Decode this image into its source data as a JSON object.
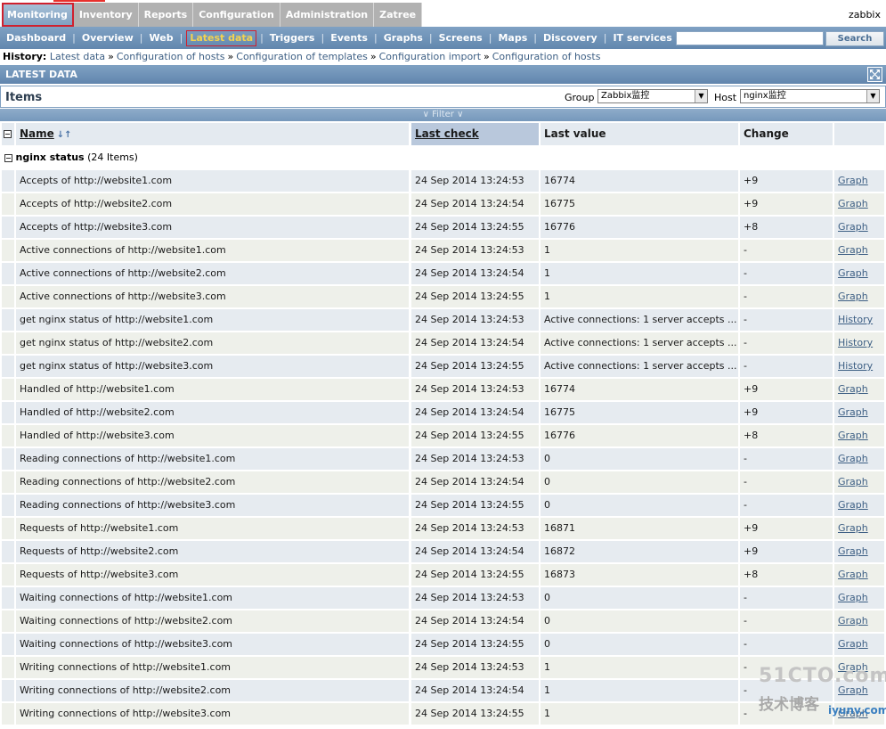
{
  "main_menu": [
    "Monitoring",
    "Inventory",
    "Reports",
    "Configuration",
    "Administration",
    "Zatree"
  ],
  "username": "zabbix",
  "sub_menu": [
    "Dashboard",
    "Overview",
    "Web",
    "Latest data",
    "Triggers",
    "Events",
    "Graphs",
    "Screens",
    "Maps",
    "Discovery",
    "IT services"
  ],
  "search": {
    "value": "",
    "button": "Search"
  },
  "history": {
    "label": "History:",
    "links": [
      "Latest data",
      "Configuration of hosts",
      "Configuration of templates",
      "Configuration import",
      "Configuration of hosts"
    ]
  },
  "section_title": "LATEST DATA",
  "items_title": "Items",
  "filter": {
    "group_label": "Group",
    "group_value": "Zabbix监控",
    "host_label": "Host",
    "host_value": "nginx监控",
    "toggle_label": "Filter"
  },
  "table": {
    "columns": {
      "name": "Name",
      "last_check": "Last check",
      "last_value": "Last value",
      "change": "Change"
    },
    "group_name": "nginx status",
    "group_count": "(24 Items)",
    "rows": [
      {
        "name": "Accepts of http://website1.com",
        "last_check": "24 Sep 2014 13:24:53",
        "last_value": "16774",
        "change": "+9",
        "action": "Graph"
      },
      {
        "name": "Accepts of http://website2.com",
        "last_check": "24 Sep 2014 13:24:54",
        "last_value": "16775",
        "change": "+9",
        "action": "Graph"
      },
      {
        "name": "Accepts of http://website3.com",
        "last_check": "24 Sep 2014 13:24:55",
        "last_value": "16776",
        "change": "+8",
        "action": "Graph"
      },
      {
        "name": "Active connections of http://website1.com",
        "last_check": "24 Sep 2014 13:24:53",
        "last_value": "1",
        "change": "-",
        "action": "Graph"
      },
      {
        "name": "Active connections of http://website2.com",
        "last_check": "24 Sep 2014 13:24:54",
        "last_value": "1",
        "change": "-",
        "action": "Graph"
      },
      {
        "name": "Active connections of http://website3.com",
        "last_check": "24 Sep 2014 13:24:55",
        "last_value": "1",
        "change": "-",
        "action": "Graph"
      },
      {
        "name": "get nginx status of http://website1.com",
        "last_check": "24 Sep 2014 13:24:53",
        "last_value": "Active connections: 1 server accepts ...",
        "change": "-",
        "action": "History"
      },
      {
        "name": "get nginx status of http://website2.com",
        "last_check": "24 Sep 2014 13:24:54",
        "last_value": "Active connections: 1 server accepts ...",
        "change": "-",
        "action": "History"
      },
      {
        "name": "get nginx status of http://website3.com",
        "last_check": "24 Sep 2014 13:24:55",
        "last_value": "Active connections: 1 server accepts ...",
        "change": "-",
        "action": "History"
      },
      {
        "name": "Handled of http://website1.com",
        "last_check": "24 Sep 2014 13:24:53",
        "last_value": "16774",
        "change": "+9",
        "action": "Graph"
      },
      {
        "name": "Handled of http://website2.com",
        "last_check": "24 Sep 2014 13:24:54",
        "last_value": "16775",
        "change": "+9",
        "action": "Graph"
      },
      {
        "name": "Handled of http://website3.com",
        "last_check": "24 Sep 2014 13:24:55",
        "last_value": "16776",
        "change": "+8",
        "action": "Graph"
      },
      {
        "name": "Reading connections of http://website1.com",
        "last_check": "24 Sep 2014 13:24:53",
        "last_value": "0",
        "change": "-",
        "action": "Graph"
      },
      {
        "name": "Reading connections of http://website2.com",
        "last_check": "24 Sep 2014 13:24:54",
        "last_value": "0",
        "change": "-",
        "action": "Graph"
      },
      {
        "name": "Reading connections of http://website3.com",
        "last_check": "24 Sep 2014 13:24:55",
        "last_value": "0",
        "change": "-",
        "action": "Graph"
      },
      {
        "name": "Requests of http://website1.com",
        "last_check": "24 Sep 2014 13:24:53",
        "last_value": "16871",
        "change": "+9",
        "action": "Graph"
      },
      {
        "name": "Requests of http://website2.com",
        "last_check": "24 Sep 2014 13:24:54",
        "last_value": "16872",
        "change": "+9",
        "action": "Graph"
      },
      {
        "name": "Requests of http://website3.com",
        "last_check": "24 Sep 2014 13:24:55",
        "last_value": "16873",
        "change": "+8",
        "action": "Graph"
      },
      {
        "name": "Waiting connections of http://website1.com",
        "last_check": "24 Sep 2014 13:24:53",
        "last_value": "0",
        "change": "-",
        "action": "Graph"
      },
      {
        "name": "Waiting connections of http://website2.com",
        "last_check": "24 Sep 2014 13:24:54",
        "last_value": "0",
        "change": "-",
        "action": "Graph"
      },
      {
        "name": "Waiting connections of http://website3.com",
        "last_check": "24 Sep 2014 13:24:55",
        "last_value": "0",
        "change": "-",
        "action": "Graph"
      },
      {
        "name": "Writing connections of http://website1.com",
        "last_check": "24 Sep 2014 13:24:53",
        "last_value": "1",
        "change": "-",
        "action": "Graph"
      },
      {
        "name": "Writing connections of http://website2.com",
        "last_check": "24 Sep 2014 13:24:54",
        "last_value": "1",
        "change": "-",
        "action": "Graph"
      },
      {
        "name": "Writing connections of http://website3.com",
        "last_check": "24 Sep 2014 13:24:55",
        "last_value": "1",
        "change": "-",
        "action": "Graph"
      }
    ]
  },
  "watermark": {
    "line1": "51CTO.com",
    "line2": "技术博客",
    "line3": "iyunv.com"
  },
  "colors": {
    "header_blue": "#7fa1c3",
    "active_tab_text": "#f3d34f",
    "link": "#3d5f84",
    "row_bg": "#e6ebf0"
  }
}
